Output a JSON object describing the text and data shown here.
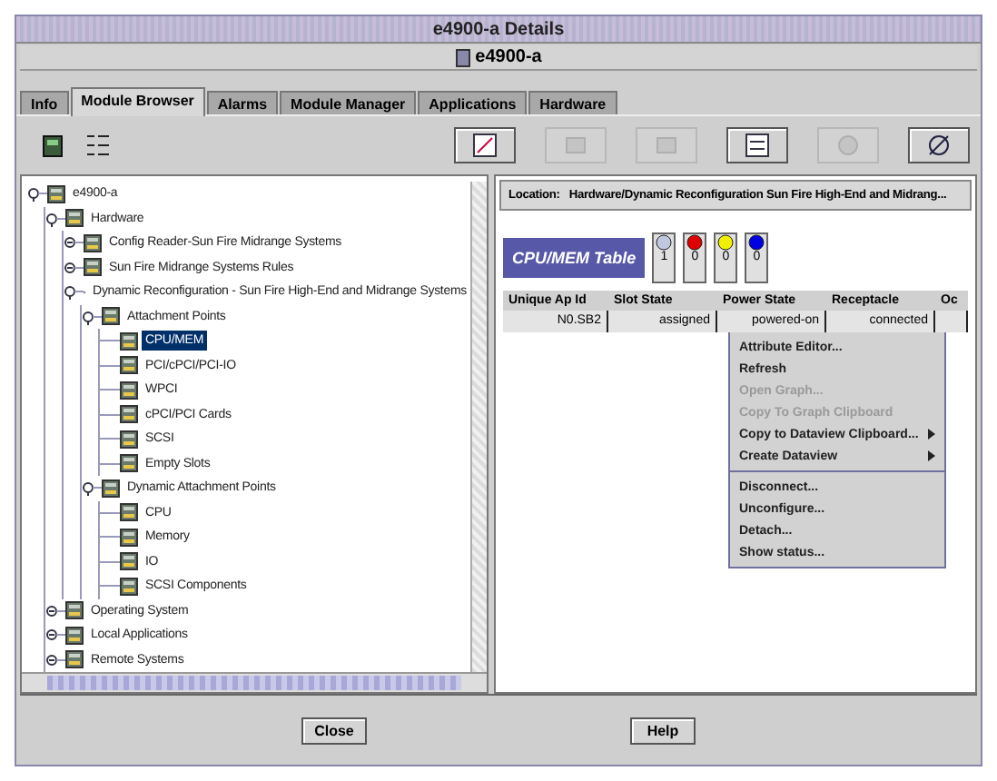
{
  "window": {
    "title": "e4900-a Details"
  },
  "header": {
    "host": "e4900-a"
  },
  "tabs": [
    {
      "label": "Info",
      "selected": false
    },
    {
      "label": "Module Browser",
      "selected": true
    },
    {
      "label": "Alarms",
      "selected": false
    },
    {
      "label": "Module Manager",
      "selected": false
    },
    {
      "label": "Applications",
      "selected": false
    },
    {
      "label": "Hardware",
      "selected": false
    }
  ],
  "toolbar": {
    "buttons": [
      {
        "disabled": false
      },
      {
        "disabled": true
      },
      {
        "disabled": true
      },
      {
        "disabled": false
      },
      {
        "disabled": true
      },
      {
        "disabled": false
      }
    ]
  },
  "tree": [
    {
      "label": "e4900-a",
      "selected": false,
      "expanded": true,
      "children": [
        {
          "label": "Hardware",
          "selected": false,
          "expanded": true,
          "children": [
            {
              "label": "Config Reader-Sun Fire Midrange Systems",
              "selected": false,
              "expanded": false
            },
            {
              "label": "Sun Fire Midrange Systems Rules",
              "selected": false,
              "expanded": false
            },
            {
              "label": "Dynamic Reconfiguration - Sun Fire High-End and Midrange Systems",
              "selected": false,
              "expanded": true,
              "children": [
                {
                  "label": "Attachment Points",
                  "selected": false,
                  "expanded": true,
                  "children": [
                    {
                      "label": "CPU/MEM",
                      "selected": true
                    },
                    {
                      "label": "PCI/cPCI/PCI-IO",
                      "selected": false
                    },
                    {
                      "label": "WPCI",
                      "selected": false
                    },
                    {
                      "label": "cPCI/PCI Cards",
                      "selected": false
                    },
                    {
                      "label": "SCSI",
                      "selected": false
                    },
                    {
                      "label": "Empty Slots",
                      "selected": false
                    }
                  ]
                },
                {
                  "label": "Dynamic Attachment Points",
                  "selected": false,
                  "expanded": true,
                  "children": [
                    {
                      "label": "CPU",
                      "selected": false
                    },
                    {
                      "label": "Memory",
                      "selected": false
                    },
                    {
                      "label": "IO",
                      "selected": false
                    },
                    {
                      "label": "SCSI Components",
                      "selected": false
                    }
                  ]
                }
              ]
            }
          ]
        },
        {
          "label": "Operating System",
          "selected": false,
          "expanded": false
        },
        {
          "label": "Local Applications",
          "selected": false,
          "expanded": false
        },
        {
          "label": "Remote Systems",
          "selected": false,
          "expanded": false
        }
      ]
    }
  ],
  "location": {
    "label": "Location:",
    "value": "Hardware/Dynamic Reconfiguration Sun Fire High-End and Midrang..."
  },
  "table": {
    "title": "CPU/MEM Table",
    "status_counts": [
      {
        "count": "1",
        "color": "#c0c8e0"
      },
      {
        "count": "0",
        "color": "#e00000"
      },
      {
        "count": "0",
        "color": "#f0f000"
      },
      {
        "count": "0",
        "color": "#0000e0"
      }
    ],
    "columns": [
      "Unique Ap Id",
      "Slot State",
      "Power State",
      "Receptacle",
      "Oc"
    ],
    "rows": [
      [
        "N0.SB2",
        "assigned",
        "powered-on",
        "connected"
      ]
    ]
  },
  "context_menu": {
    "groups": [
      [
        {
          "label": "Attribute Editor...",
          "disabled": false,
          "submenu": false
        },
        {
          "label": "Refresh",
          "disabled": false,
          "submenu": false
        },
        {
          "label": "Open Graph...",
          "disabled": true,
          "submenu": false
        },
        {
          "label": "Copy To Graph Clipboard",
          "disabled": true,
          "submenu": false
        },
        {
          "label": "Copy to Dataview Clipboard...",
          "disabled": false,
          "submenu": true
        },
        {
          "label": "Create Dataview",
          "disabled": false,
          "submenu": true
        }
      ],
      [
        {
          "label": "Disconnect...",
          "disabled": false,
          "submenu": false
        },
        {
          "label": "Unconfigure...",
          "disabled": false,
          "submenu": false
        },
        {
          "label": "Detach...",
          "disabled": false,
          "submenu": false
        },
        {
          "label": "Show status...",
          "disabled": false,
          "submenu": false
        }
      ]
    ]
  },
  "buttons": [
    "Close",
    "Help"
  ]
}
